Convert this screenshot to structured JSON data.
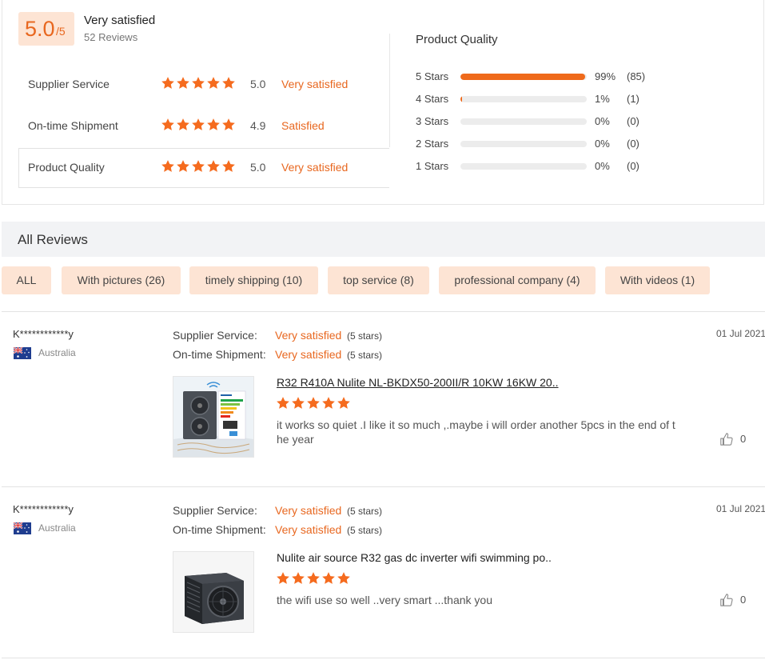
{
  "summary": {
    "score": "5.0",
    "score_suffix": "/5",
    "label": "Very satisfied",
    "review_count": "52 Reviews",
    "metrics": [
      {
        "label": "Supplier Service",
        "score": "5.0",
        "status": "Very satisfied",
        "rating": 5
      },
      {
        "label": "On-time Shipment",
        "score": "4.9",
        "status": "Satisfied",
        "rating": 5
      },
      {
        "label": "Product Quality",
        "score": "5.0",
        "status": "Very satisfied",
        "rating": 5
      }
    ]
  },
  "distribution": {
    "title": "Product Quality",
    "rows": [
      {
        "label": "5 Stars",
        "fraction": 0.99,
        "percent": "99%",
        "count": "(85)"
      },
      {
        "label": "4 Stars",
        "fraction": 0.01,
        "percent": "1%",
        "count": "(1)"
      },
      {
        "label": "3 Stars",
        "fraction": 0,
        "percent": "0%",
        "count": "(0)"
      },
      {
        "label": "2 Stars",
        "fraction": 0,
        "percent": "0%",
        "count": "(0)"
      },
      {
        "label": "1 Stars",
        "fraction": 0,
        "percent": "0%",
        "count": "(0)"
      }
    ],
    "fill_color": "#ef6a1b"
  },
  "all_reviews": {
    "title": "All Reviews",
    "filters": [
      "ALL",
      "With pictures (26)",
      "timely shipping (10)",
      "top service (8)",
      "professional company (4)",
      "With videos (1)"
    ]
  },
  "reviews": [
    {
      "name": "K************y",
      "country": "Australia",
      "supplier_label": "Supplier Service:",
      "supplier_value": "Very satisfied",
      "supplier_stars": "(5 stars)",
      "shipment_label": "On-time Shipment:",
      "shipment_value": "Very satisfied",
      "shipment_stars": "(5 stars)",
      "date": "01 Jul 2021",
      "product": "R32 R410A Nulite NL-BKDX50-200II/R 10KW 16KW 20..",
      "rating": 5,
      "text": "it works so quiet .I like it so much ,.maybe i will order another 5pcs in the end of the year",
      "likes": "0"
    },
    {
      "name": "K************y",
      "country": "Australia",
      "supplier_label": "Supplier Service:",
      "supplier_value": "Very satisfied",
      "supplier_stars": "(5 stars)",
      "shipment_label": "On-time Shipment:",
      "shipment_value": "Very satisfied",
      "shipment_stars": "(5 stars)",
      "date": "01 Jul 2021",
      "product": "Nulite air source R32 gas dc inverter wifi swimming po..",
      "rating": 5,
      "text": "the wifi use so well ..very smart ...thank you",
      "likes": "0"
    }
  ],
  "colors": {
    "accent": "#e8671f",
    "chip_bg": "#fde4d4",
    "star": "#f56b1e"
  }
}
